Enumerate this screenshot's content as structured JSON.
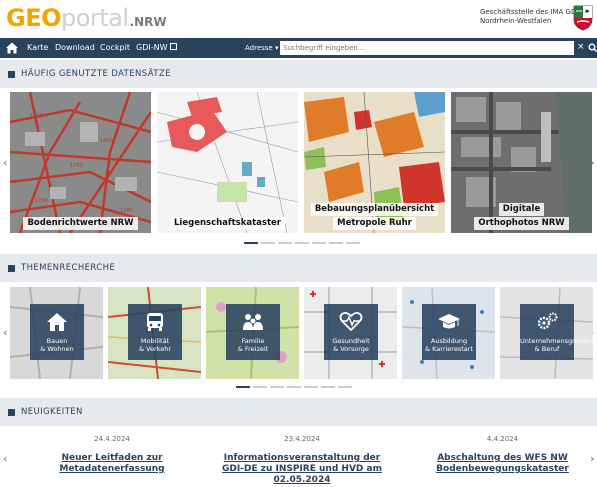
{
  "header": {
    "logo": {
      "geo": "GEO",
      "portal": "portal",
      "nrw": ".NRW"
    },
    "org_line1": "Geschäftsstelle des IMA GDI",
    "org_line2": "Nordrhein-Westfalen",
    "crest_icon": "nrw-coat-of-arms-icon"
  },
  "nav": {
    "home_icon": "home-icon",
    "links": [
      "Karte",
      "Download",
      "Cockpit",
      "GDI-NW"
    ],
    "address_select": "Adresse ▾",
    "search_placeholder": "Suchbegriff eingeben...",
    "clear_label": "×"
  },
  "sections": {
    "datasets_title": "HÄUFIG GENUTZTE DATENSÄTZE",
    "themes_title": "THEMENRECHERCHE",
    "news_title": "NEUIGKEITEN"
  },
  "datasets": [
    {
      "line1": "Bodenrichtwerte NRW",
      "line2": ""
    },
    {
      "line1": "Liegenschaftskataster",
      "line2": ""
    },
    {
      "line1": "Bebauungsplanübersicht",
      "line2": "Metropole Ruhr"
    },
    {
      "line1": "Digitale",
      "line2": "Orthophotos NRW"
    }
  ],
  "themes": [
    {
      "line1": "Bauen",
      "line2": "& Wohnen",
      "icon": "house-icon"
    },
    {
      "line1": "Mobilität",
      "line2": "& Verkehr",
      "icon": "bus-icon"
    },
    {
      "line1": "Familie",
      "line2": "& Freizeit",
      "icon": "family-icon"
    },
    {
      "line1": "Gesundheit",
      "line2": "& Vorsorge",
      "icon": "heartbeat-icon"
    },
    {
      "line1": "Ausbildung",
      "line2": "& Karrierestart",
      "icon": "graduation-cap-icon"
    },
    {
      "line1": "Unternehmensgründung",
      "line2": "& Beruf",
      "icon": "gears-icon"
    }
  ],
  "news": [
    {
      "date": "24.4.2024",
      "title": "Neuer Leitfaden zur Metadatenerfassung"
    },
    {
      "date": "23.4.2024",
      "title": "Informationsveranstaltung der GDI-DE zu INSPIRE und HVD am 02.05.2024"
    },
    {
      "date": "4.4.2024",
      "title": "Abschaltung des WFS NW Bodenbewegungskataster"
    }
  ],
  "colors": {
    "nav": "#29425e",
    "accent_logo": "#f0a500",
    "section_bg": "#e6eaef"
  }
}
